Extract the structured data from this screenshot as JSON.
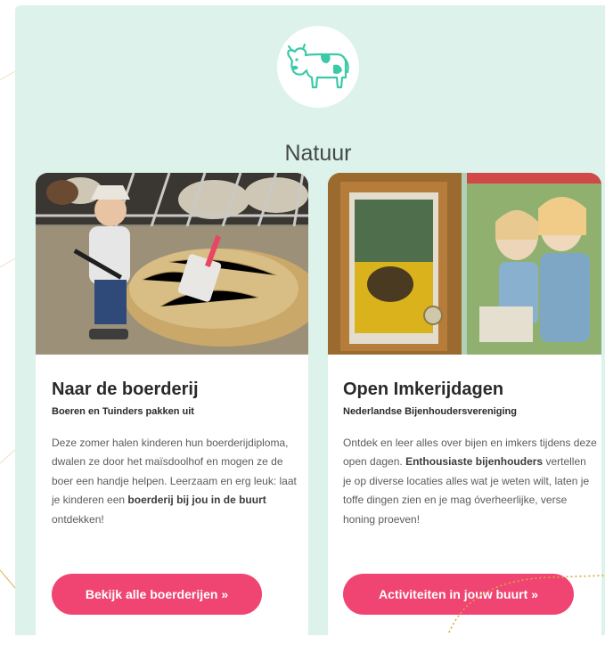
{
  "section": {
    "title": "Natuur",
    "icon": "cow-icon",
    "background_color": "#dcf2eb",
    "accent_color": "#3cc9a7"
  },
  "cards": [
    {
      "title": "Naar de boerderij",
      "subtitle": "Boeren en Tuinders pakken uit",
      "body_parts": [
        "Deze zomer halen kinderen hun boerderijdiploma, dwalen ze door het maïsdoolhof en mogen ze de boer een handje helpen. Leerzaam en erg leuk: laat je kinderen een ",
        "boerderij bij jou in de buurt",
        " ontdekken!"
      ],
      "button_label": "Bekijk alle boerderijen »",
      "image_alt": "Kind met kruiwagen vol hooi bij een koeienstal"
    },
    {
      "title": "Open Imkerijdagen",
      "subtitle": "Nederlandse Bijenhoudersvereniging",
      "body_parts": [
        "Ontdek en leer alles over bijen en imkers tijdens deze open dagen. ",
        "Enthousiaste bijenhouders",
        " vertellen je op diverse locaties alles wat je weten wilt, laten je toffe dingen zien en je mag óverheerlijke, verse honing proeven!"
      ],
      "button_label": "Activiteiten in jouw buurt »",
      "image_alt": "Twee meisjes bekijken een observatiekast met bijen"
    }
  ],
  "button_color": "#f04472"
}
